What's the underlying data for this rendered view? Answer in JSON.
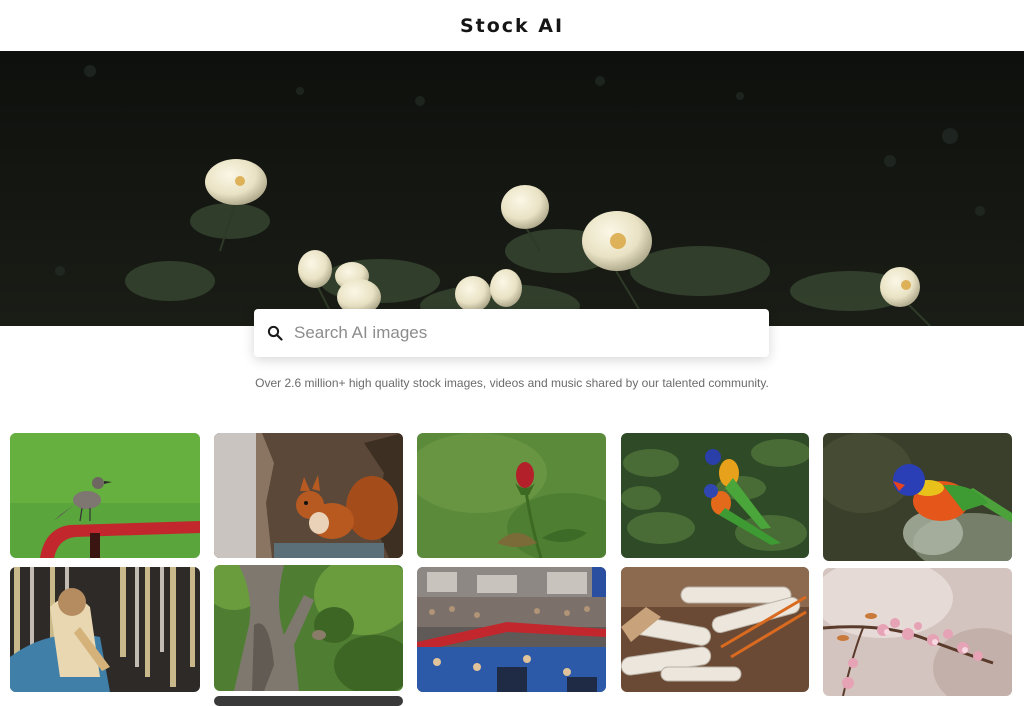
{
  "header": {
    "title": "Stock AI"
  },
  "hero": {
    "alt": "white roses in dark foliage"
  },
  "search": {
    "placeholder": "Search AI images",
    "value": ""
  },
  "tagline": "Over 2.6 million+ high quality stock images, videos and music shared by our talented community.",
  "colors": {
    "brand_text": "#151515",
    "tagline": "#6b6b6b",
    "placeholder": "#8c8c8c"
  },
  "images": [
    {
      "subject": "bird-on-red-railing"
    },
    {
      "subject": "red-squirrel-on-tree"
    },
    {
      "subject": "red-rose-bud"
    },
    {
      "subject": "rainbow-lorikeets-in-tree"
    },
    {
      "subject": "rainbow-lorikeet-portrait"
    },
    {
      "subject": "religious-statue-with-ribbons"
    },
    {
      "subject": "tree-trunk-with-bird"
    },
    {
      "subject": "crowded-stadium-stands"
    },
    {
      "subject": "rolled-papers-and-pencils"
    },
    {
      "subject": "pink-cherry-blossoms"
    }
  ]
}
